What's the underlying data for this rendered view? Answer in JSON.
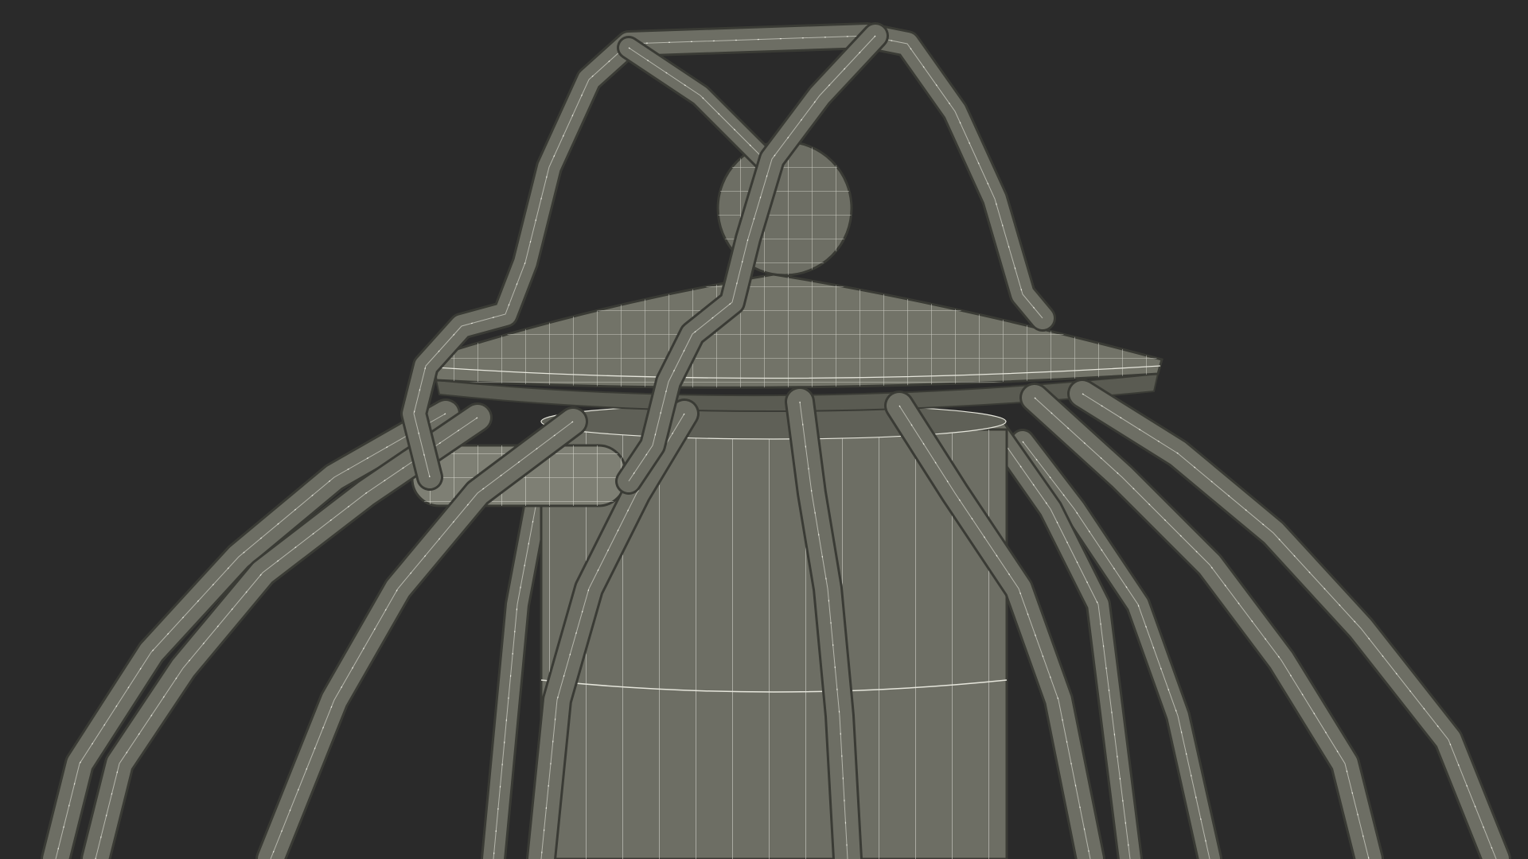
{
  "scene": {
    "subject": "wireframe-lantern-render",
    "colors": {
      "background": "#2a2a2a",
      "surface": "#6d6e64",
      "surface_dark": "#5f6057",
      "surface_light": "#7e7f74",
      "outline": "#3a3b35",
      "wire": "#e6e6dc"
    }
  }
}
